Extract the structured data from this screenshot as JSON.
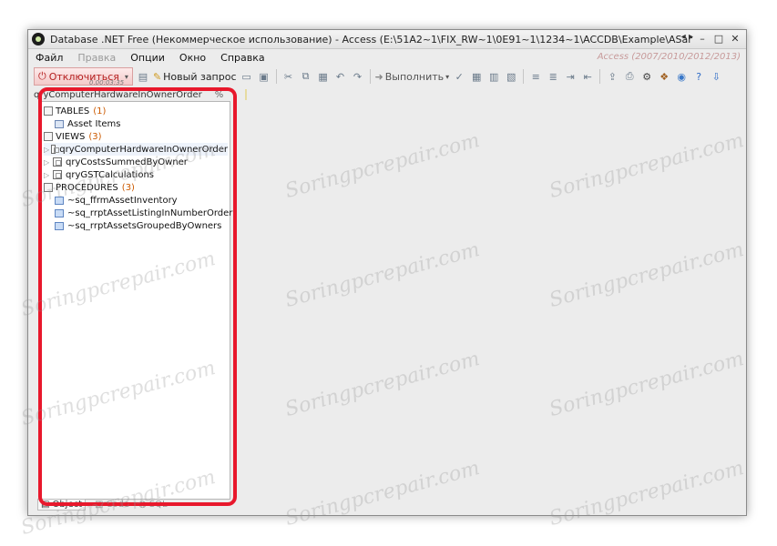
{
  "window": {
    "title": "Database .NET Free (Некоммерческое использование) - Access (E:\\51A2~1\\FIX_RW~1\\0E91~1\\1234~1\\ACCDB\\Example\\ASampleDatabase.accdb) - qr...",
    "nav_arrows": "◂ ▸",
    "minimize": "–",
    "maximize": "□",
    "close": "✕"
  },
  "menu": {
    "file": "Файл",
    "edit": "Правка",
    "options": "Опции",
    "window": "Окно",
    "help": "Справка"
  },
  "access_version": "Access (2007/2010/2012/2013)",
  "toolbar": {
    "disconnect_label": "Отключиться",
    "timer": "0.00:03:35",
    "new_query_label": "Новый запрос",
    "execute_label": "Выполнить"
  },
  "doc_tab": {
    "label": "qryComputerHardwareInOwnerOrder",
    "pct": "%"
  },
  "tree": {
    "tables": {
      "label": "TABLES",
      "count": "(1)",
      "items": [
        "Asset Items"
      ]
    },
    "views": {
      "label": "VIEWS",
      "count": "(3)",
      "items": [
        "qryComputerHardwareInOwnerOrder",
        "qryCostsSummedByOwner",
        "qryGSTCalculations"
      ]
    },
    "procedures": {
      "label": "PROCEDURES",
      "count": "(3)",
      "items": [
        "~sq_ffrmAssetInventory",
        "~sq_rrptAssetListingInNumberOrder",
        "~sq_rrptAssetsGroupedByOwners"
      ]
    }
  },
  "bottom_tabs": {
    "object": "Object",
    "code": "Code",
    "sql": "SQL"
  },
  "watermark": "Soringpcrepair.com",
  "colors": {
    "highlight_outline": "#e8182c",
    "count_color": "#cc5a00"
  }
}
